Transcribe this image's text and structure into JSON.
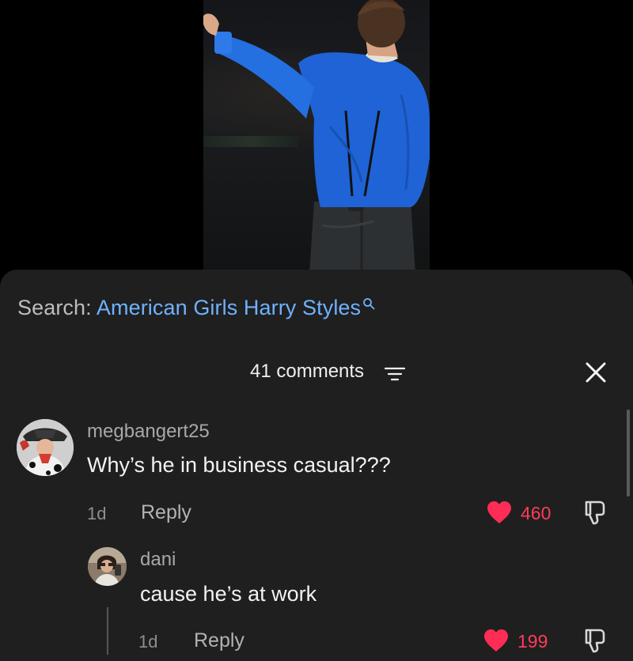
{
  "search": {
    "prefix": "Search:",
    "query": "American Girls Harry Styles"
  },
  "comments_header": {
    "count_label": "41 comments"
  },
  "comments": [
    {
      "username": "megbangert25",
      "text": "Why’s he in business casual???",
      "time": "1d",
      "reply_label": "Reply",
      "likes": "460"
    },
    {
      "username": "dani",
      "text": "cause he’s at work",
      "time": "1d",
      "reply_label": "Reply",
      "likes": "199"
    }
  ],
  "colors": {
    "panel_bg": "#1f1f1f",
    "search_query": "#6fb2ff",
    "like_red": "#ff3b5c",
    "shirt_blue": "#1f63d6"
  },
  "icons": {
    "search": "search-icon",
    "filter": "filter-icon",
    "close": "close-icon",
    "like": "heart-icon",
    "dislike": "thumbs-down-icon"
  }
}
